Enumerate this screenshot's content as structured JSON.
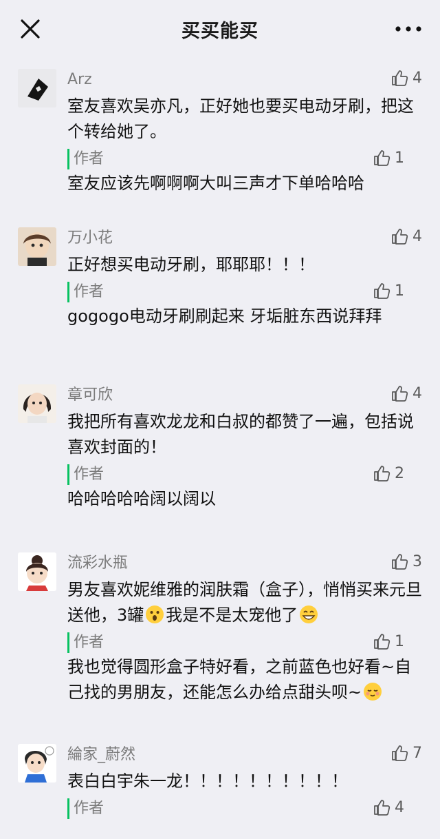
{
  "header": {
    "title": "买买能买"
  },
  "colors": {
    "background": "#efeff4",
    "author_accent": "#07c160"
  },
  "comments": [
    {
      "name": "Arz",
      "likes": "4",
      "text": "室友喜欢吴亦凡，正好她也要买电动牙刷，把这个转给她了。",
      "reply": {
        "tag": "作者",
        "likes": "1",
        "text": "室友应该先啊啊啊大叫三声才下单哈哈哈"
      }
    },
    {
      "name": "万小花",
      "likes": "4",
      "text": "正好想买电动牙刷，耶耶耶！！！",
      "reply": {
        "tag": "作者",
        "likes": "1",
        "text": "gogogo电动牙刷刷起来 牙垢脏东西说拜拜"
      }
    },
    {
      "name": "章可欣",
      "likes": "4",
      "text": "我把所有喜欢龙龙和白叔的都赞了一遍，包括说喜欢封面的！",
      "reply": {
        "tag": "作者",
        "likes": "2",
        "text": "哈哈哈哈哈阔以阔以"
      }
    },
    {
      "name": "流彩水瓶",
      "likes": "3",
      "text_a": "男友喜欢妮维雅的润肤霜（盒子），悄悄买来元旦送他，3罐",
      "text_b": "我是不是太宠他了",
      "reply": {
        "tag": "作者",
        "likes": "1",
        "text": "我也觉得圆形盒子特好看，之前蓝色也好看~自己找的男朋友，还能怎么办给点甜头呗~"
      }
    },
    {
      "name": "綸家_蔚然",
      "likes": "7",
      "text": "表白白宇朱一龙！！！！！！！！！！",
      "reply": {
        "tag": "作者",
        "likes": "4"
      }
    }
  ]
}
